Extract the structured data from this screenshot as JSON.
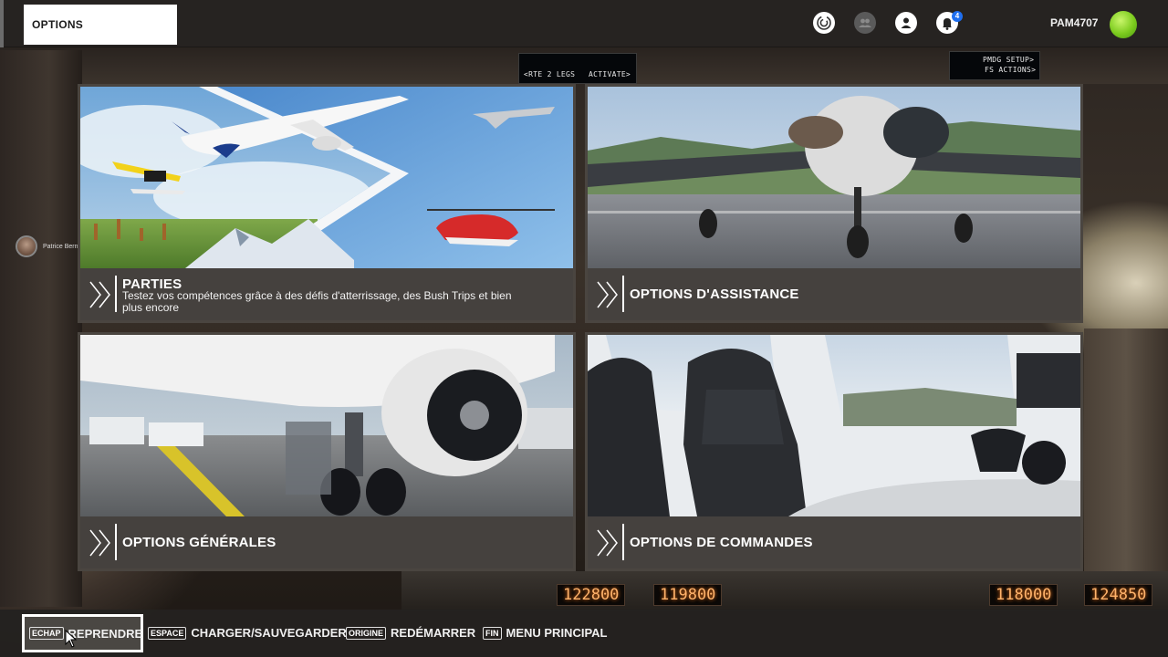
{
  "header": {
    "title": "OPTIONS",
    "username": "PAM4707",
    "notification_count": "4",
    "icons": [
      "activity-icon",
      "friends-icon",
      "profile-icon",
      "notifications-icon"
    ]
  },
  "background": {
    "fmc_left_line1": "<RTE 2 LEGS",
    "fmc_left_line2": "ACTIVATE>",
    "fmc_right_line1": "PMDG SETUP>",
    "fmc_right_line2": "FS ACTIONS>",
    "displays": [
      "122800",
      "119800",
      "118000",
      "124850"
    ]
  },
  "pilot": {
    "name": "Patrice Bernard"
  },
  "cards": [
    {
      "title": "PARTIES",
      "description": "Testez vos compétences grâce à des défis d'atterrissage, des Bush Trips et bien plus encore"
    },
    {
      "title": "OPTIONS D'ASSISTANCE"
    },
    {
      "title": "OPTIONS GÉNÉRALES"
    },
    {
      "title": "OPTIONS DE COMMANDES"
    }
  ],
  "footer": {
    "hints": [
      {
        "key": "ECHAP",
        "label": "REPRENDRE"
      },
      {
        "key": "ESPACE",
        "label": "CHARGER/SAUVEGARDER"
      },
      {
        "key": "ORIGINE",
        "label": "REDÉMARRER"
      },
      {
        "key": "FIN",
        "label": "MENU PRINCIPAL"
      }
    ]
  },
  "colors": {
    "accent_white": "#ffffff",
    "avatar_green": "#7ccb1e",
    "badge_blue": "#1f6ff0",
    "display_amber": "#ffb36b"
  }
}
